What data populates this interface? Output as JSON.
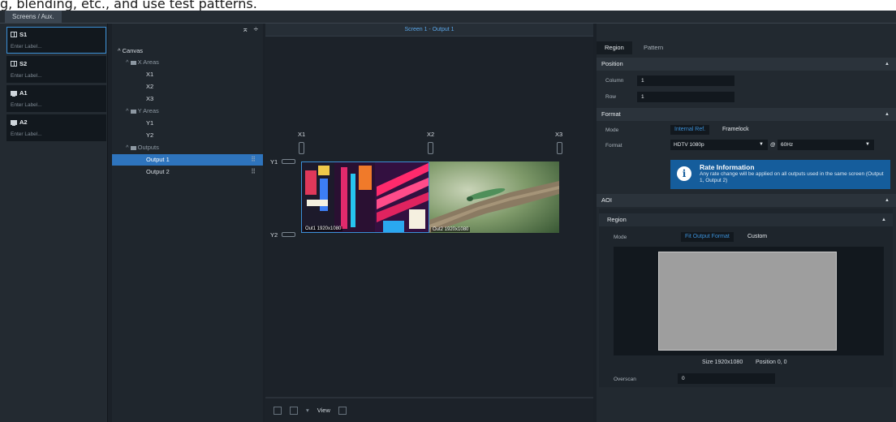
{
  "caption": "g, blending, etc., and use test patterns.",
  "tab": "Screens / Aux.",
  "screens": [
    {
      "name": "S1",
      "label": "Enter Label...",
      "icon": "screen-split-icon",
      "selected": true
    },
    {
      "name": "S2",
      "label": "Enter Label...",
      "icon": "screen-split-icon",
      "selected": false
    },
    {
      "name": "A1",
      "label": "Enter Label...",
      "icon": "monitor-icon",
      "selected": false
    },
    {
      "name": "A2",
      "label": "Enter Label...",
      "icon": "monitor-icon",
      "selected": false
    }
  ],
  "tree": {
    "root": "Canvas",
    "x_areas": "X Areas",
    "x_items": [
      "X1",
      "X2",
      "X3"
    ],
    "y_areas": "Y Areas",
    "y_items": [
      "Y1",
      "Y2"
    ],
    "outputs": "Outputs",
    "output_items": [
      "Output 1",
      "Output 2"
    ],
    "selected_output": "Output 1"
  },
  "canvas": {
    "title": "Screen 1 - Output 1",
    "x_labels": [
      "X1",
      "X2",
      "X3"
    ],
    "y_labels": [
      "Y1",
      "Y2"
    ],
    "out1_label": "Out1 1920x1080",
    "out2_label": "Out2 1920x1080",
    "view_label": "View"
  },
  "props": {
    "tabs": [
      "Region",
      "Pattern"
    ],
    "active_tab": "Region",
    "position": {
      "title": "Position",
      "column_label": "Column",
      "column": "1",
      "row_label": "Row",
      "row": "1"
    },
    "format": {
      "title": "Format",
      "mode_label": "Mode",
      "mode_on": "Internal Ref.",
      "mode_off": "Framelock",
      "format_label": "Format",
      "format_value": "HDTV 1080p",
      "at": "@",
      "rate_value": "60Hz"
    },
    "info": {
      "title": "Rate Information",
      "text": "Any rate change will be applied on all outputs used in the same screen (Output 1, Output 2)"
    },
    "aoi": {
      "title": "AOI",
      "region_title": "Region",
      "mode_label": "Mode",
      "mode_on": "Fit Output Format",
      "mode_off": "Custom",
      "size": "Size 1920x1080",
      "position": "Position 0, 0",
      "overscan_label": "Overscan",
      "overscan": "0"
    }
  },
  "colors": {
    "accent": "#2e74bd",
    "info": "#155d9c",
    "link": "#3b8fd6"
  }
}
